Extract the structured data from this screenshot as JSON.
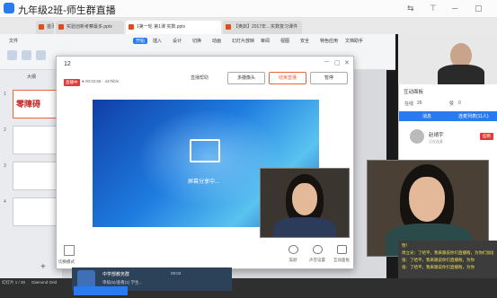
{
  "window": {
    "title": "九年级2班-师生群直播"
  },
  "browser_tabs": [
    {
      "label": "首页",
      "color": "#e64a19"
    },
    {
      "label": "实验创新考察最多.pptx",
      "color": "#e64a19"
    },
    {
      "label": "1第一轮 第1课 实数.pptx",
      "color": "#e64a19"
    },
    {
      "label": "【奥启】2017年…实数复习课件",
      "color": "#e64a19"
    }
  ],
  "ribbon": {
    "file_menu": "文件",
    "menus": [
      "开始",
      "插入",
      "设计",
      "切换",
      "动画",
      "幻灯片放映",
      "审阅",
      "视图",
      "安全",
      "特色应用",
      "文档助手"
    ]
  },
  "slides": {
    "panel_label": "大纲",
    "numbers": [
      "1",
      "2",
      "3",
      "4"
    ],
    "thumb1_text": "零障碍"
  },
  "dialog": {
    "title": "12",
    "live_badge": "直播中",
    "time_info": "● 00:02:58 · 447kb/s",
    "help": "直播帮助",
    "buttons": {
      "multi_cam": "多摄像头",
      "end_live": "结束直播",
      "pause": "暂停"
    },
    "share_text": "屏幕分享中...",
    "switch_label": "切换模式",
    "bottom_tools": [
      "美颜",
      "声音设置",
      "互动面板"
    ]
  },
  "right_panel": {
    "title": "互动面板",
    "stats": {
      "online_label": "在线",
      "online_count": "26",
      "likes_label": "赞",
      "likes_count": "0"
    },
    "tabs": [
      "消息",
      "连麦列表(11人)"
    ],
    "user": {
      "name": "赵靖宇",
      "role": "正在连麦",
      "button": "挂断"
    }
  },
  "chat": {
    "lines": [
      "赞！",
      "周立光：了哈平，我来跟说你们直播啦，为你们加油",
      "张：了哈平，我来跟说你们直播啦，为你",
      "张：了哈平，我来跟说你们直播啦，为你"
    ]
  },
  "live_card": {
    "name": "中学部教务群",
    "time": "09:03",
    "subtitle": "审核(5)/查看(1) 学生..."
  },
  "footer": {
    "slide_info": "幻灯片 1 / 30",
    "theme": "Diamond Grid"
  },
  "colors": {
    "accent": "#2b7bf0",
    "end_button": "#f0623a",
    "live_red": "#e53935"
  }
}
